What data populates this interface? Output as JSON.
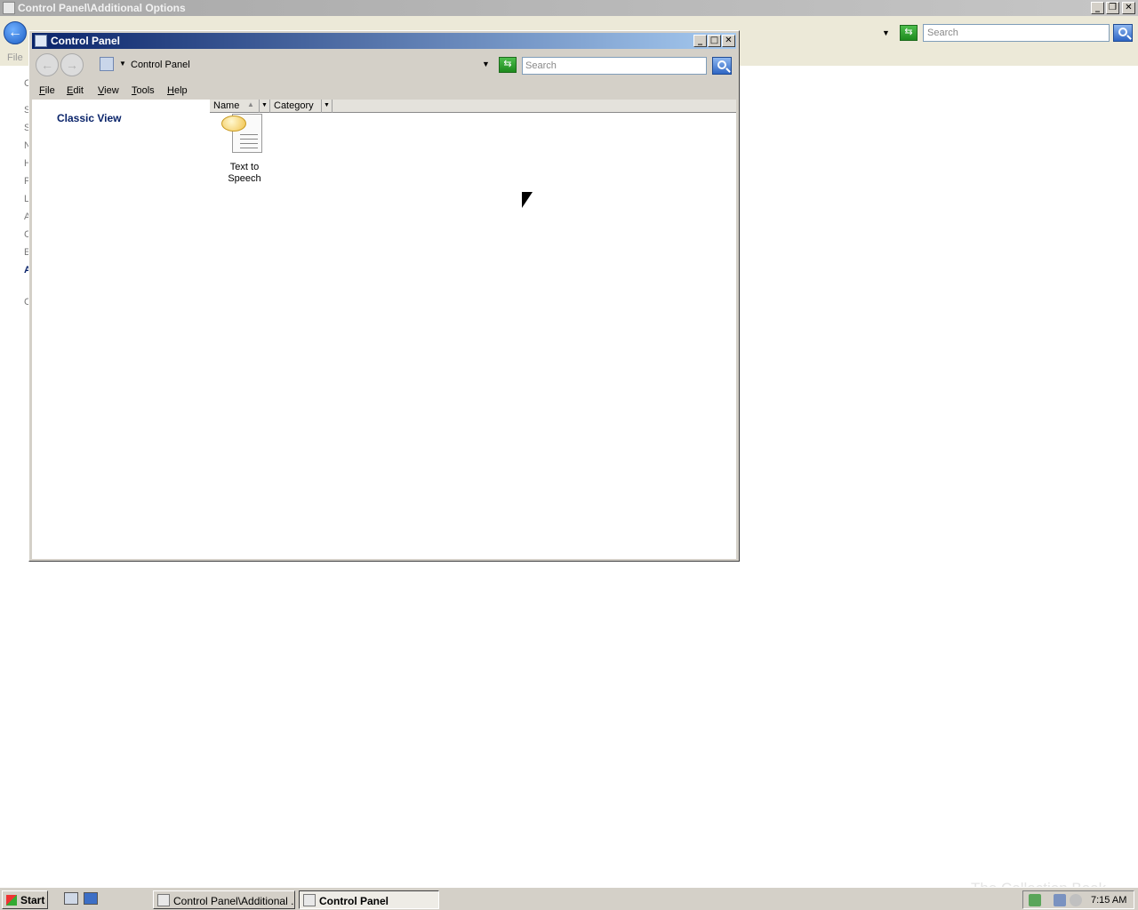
{
  "background_window": {
    "title": "Control Panel\\Additional Options",
    "search_placeholder": "Search",
    "menu_file": "File",
    "sidebar_letters": [
      "C",
      "S",
      "S",
      "N",
      "H",
      "P",
      "L",
      "A",
      "C",
      "E",
      "A",
      "C"
    ]
  },
  "window": {
    "title": "Control Panel",
    "address": "Control Panel",
    "search_placeholder": "Search",
    "menu": [
      "File",
      "Edit",
      "View",
      "Tools",
      "Help"
    ],
    "classic_view_link": "Classic View",
    "columns": [
      "Name",
      "Category"
    ],
    "items": [
      {
        "label": "Text to Speech",
        "icon": "text-to-speech-icon"
      }
    ]
  },
  "taskbar": {
    "start_label": "Start",
    "tasks": [
      {
        "label": "Control Panel\\Additional ...",
        "active": false
      },
      {
        "label": "Control Panel",
        "active": true
      }
    ],
    "clock": "7:15 AM"
  },
  "watermark": "The Collection Book"
}
